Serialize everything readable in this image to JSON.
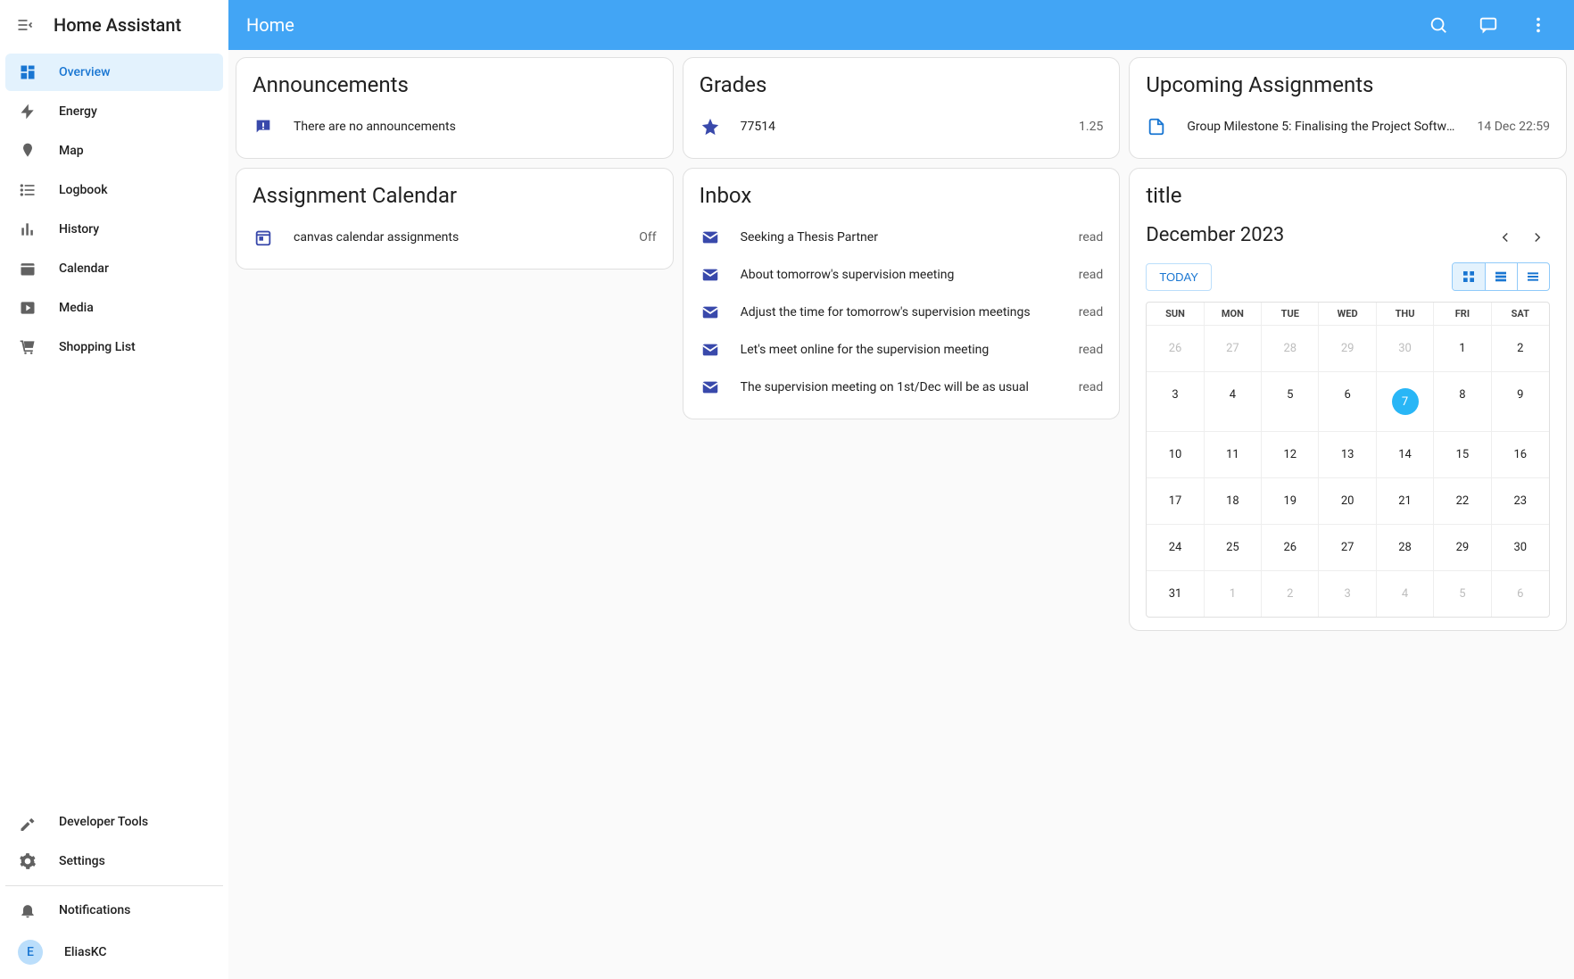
{
  "app_title": "Home Assistant",
  "topbar": {
    "title": "Home"
  },
  "sidebar": {
    "items": [
      {
        "label": "Overview"
      },
      {
        "label": "Energy"
      },
      {
        "label": "Map"
      },
      {
        "label": "Logbook"
      },
      {
        "label": "History"
      },
      {
        "label": "Calendar"
      },
      {
        "label": "Media"
      },
      {
        "label": "Shopping List"
      }
    ],
    "bottom": [
      {
        "label": "Developer Tools"
      },
      {
        "label": "Settings"
      }
    ],
    "notifications": "Notifications",
    "user": {
      "initial": "E",
      "name": "EliasKC"
    }
  },
  "cards": {
    "announcements": {
      "title": "Announcements",
      "empty": "There are no announcements"
    },
    "grades": {
      "title": "Grades",
      "id": "77514",
      "value": "1.25"
    },
    "upcoming": {
      "title": "Upcoming Assignments",
      "item": "Group Milestone 5: Finalising the Project Softwar…",
      "due": "14 Dec 22:59"
    },
    "assignment_cal": {
      "title": "Assignment Calendar",
      "item": "canvas calendar assignments",
      "state": "Off"
    },
    "inbox": {
      "title": "Inbox",
      "items": [
        {
          "subject": "Seeking a Thesis Partner",
          "state": "read"
        },
        {
          "subject": "About tomorrow's supervision meeting",
          "state": "read"
        },
        {
          "subject": "Adjust the time for tomorrow's supervision meetings",
          "state": "read"
        },
        {
          "subject": "Let's meet online for the supervision meeting",
          "state": "read"
        },
        {
          "subject": "The supervision meeting on 1st/Dec will be as usual",
          "state": "read"
        }
      ]
    },
    "calendar": {
      "title": "title",
      "month": "December 2023",
      "today_btn": "TODAY",
      "dow": [
        "SUN",
        "MON",
        "TUE",
        "WED",
        "THU",
        "FRI",
        "SAT"
      ],
      "weeks": [
        [
          {
            "d": "26",
            "o": true
          },
          {
            "d": "27",
            "o": true
          },
          {
            "d": "28",
            "o": true
          },
          {
            "d": "29",
            "o": true
          },
          {
            "d": "30",
            "o": true
          },
          {
            "d": "1"
          },
          {
            "d": "2"
          }
        ],
        [
          {
            "d": "3"
          },
          {
            "d": "4"
          },
          {
            "d": "5"
          },
          {
            "d": "6"
          },
          {
            "d": "7",
            "t": true
          },
          {
            "d": "8"
          },
          {
            "d": "9"
          }
        ],
        [
          {
            "d": "10"
          },
          {
            "d": "11"
          },
          {
            "d": "12"
          },
          {
            "d": "13"
          },
          {
            "d": "14"
          },
          {
            "d": "15"
          },
          {
            "d": "16"
          }
        ],
        [
          {
            "d": "17"
          },
          {
            "d": "18"
          },
          {
            "d": "19"
          },
          {
            "d": "20"
          },
          {
            "d": "21"
          },
          {
            "d": "22"
          },
          {
            "d": "23"
          }
        ],
        [
          {
            "d": "24"
          },
          {
            "d": "25"
          },
          {
            "d": "26"
          },
          {
            "d": "27"
          },
          {
            "d": "28"
          },
          {
            "d": "29"
          },
          {
            "d": "30"
          }
        ],
        [
          {
            "d": "31"
          },
          {
            "d": "1",
            "o": true
          },
          {
            "d": "2",
            "o": true
          },
          {
            "d": "3",
            "o": true
          },
          {
            "d": "4",
            "o": true
          },
          {
            "d": "5",
            "o": true
          },
          {
            "d": "6",
            "o": true
          }
        ]
      ]
    }
  }
}
